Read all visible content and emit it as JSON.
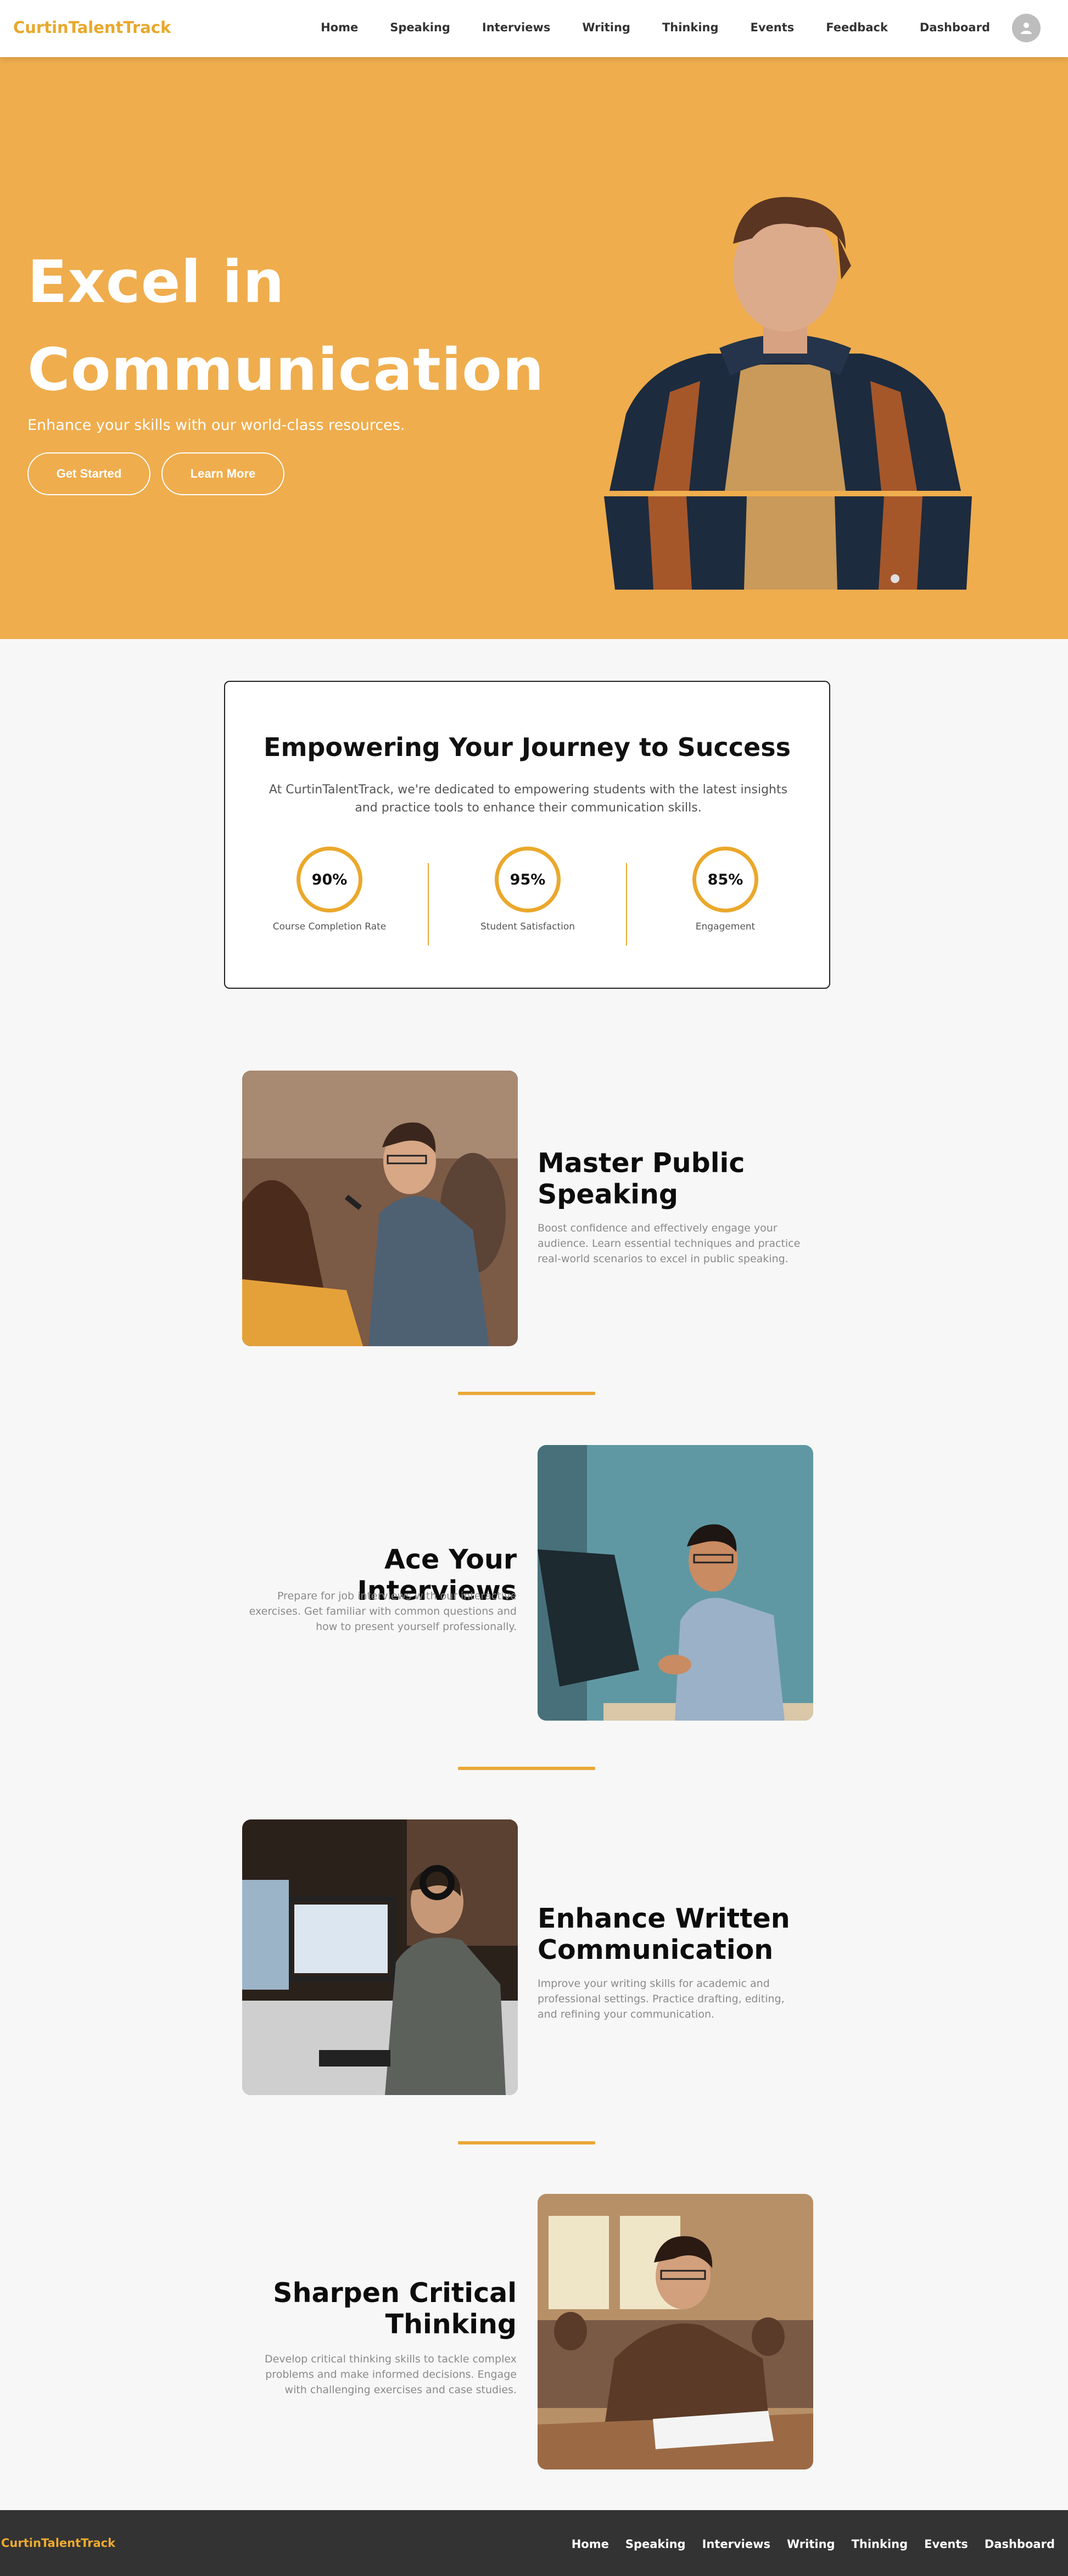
{
  "nav": {
    "brand": "CurtinTalentTrack",
    "links": [
      "Home",
      "Speaking",
      "Interviews",
      "Writing",
      "Thinking",
      "Events",
      "Feedback",
      "Dashboard"
    ]
  },
  "hero": {
    "title_line1": "Excel in",
    "title_line2": "Communication",
    "subtitle": "Enhance your skills with our world-class resources.",
    "get_started": "Get Started",
    "learn_more": "Learn More"
  },
  "mission": {
    "title": "Empowering Your Journey to Success",
    "description": "At CurtinTalentTrack, we're dedicated to empowering students with the latest insights and practice tools to enhance their communication skills.",
    "stats": [
      {
        "value": "90%",
        "label": "Course Completion Rate"
      },
      {
        "value": "95%",
        "label": "Student Satisfaction"
      },
      {
        "value": "85%",
        "label": "Engagement"
      }
    ]
  },
  "features": [
    {
      "title": "Master Public Speaking",
      "description": "Boost confidence and effectively engage your audience. Learn essential techniques and practice real-world scenarios to excel in public speaking."
    },
    {
      "title": "Ace Your Interviews",
      "description": "Prepare for job interviews with our interactive exercises. Get familiar with common questions and how to present yourself professionally."
    },
    {
      "title": "Enhance Written Communication",
      "description": "Improve your writing skills for academic and professional settings. Practice drafting, editing, and refining your communication."
    },
    {
      "title": "Sharpen Critical Thinking",
      "description": "Develop critical thinking skills to tackle complex problems and make informed decisions. Engage with challenging exercises and case studies."
    }
  ],
  "footer": {
    "brand": "CurtinTalentTrack",
    "links": [
      "Home",
      "Speaking",
      "Interviews",
      "Writing",
      "Thinking",
      "Events",
      "Dashboard"
    ]
  },
  "colors": {
    "accent": "#efad4d",
    "brand": "#e8a82c",
    "footer_bg": "#333333"
  }
}
